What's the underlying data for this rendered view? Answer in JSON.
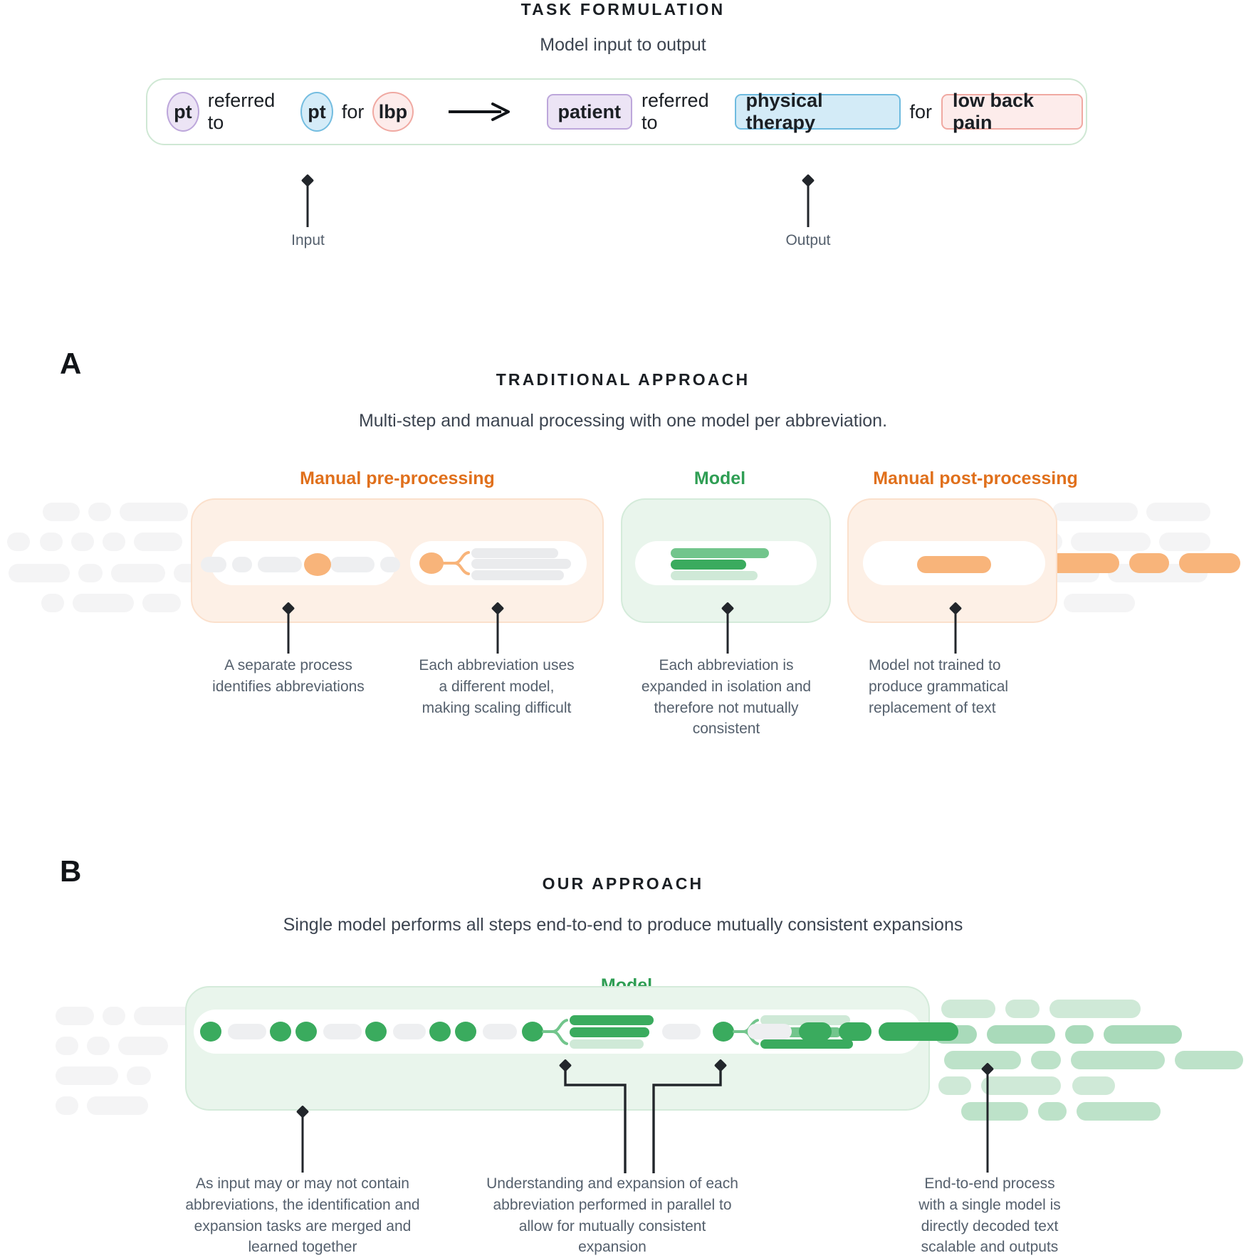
{
  "task_formulation": {
    "title": "TASK FORMULATION",
    "subtitle": "Model input to output",
    "input": {
      "tokens": [
        {
          "text": "pt",
          "kind": "abbr",
          "color": "purple"
        },
        {
          "text": "referred to",
          "kind": "plain"
        },
        {
          "text": "pt",
          "kind": "abbr",
          "color": "blue"
        },
        {
          "text": "for",
          "kind": "plain"
        },
        {
          "text": "lbp",
          "kind": "abbr",
          "color": "pink"
        }
      ]
    },
    "arrow_icon": "right-arrow-icon",
    "output": {
      "tokens": [
        {
          "text": "patient",
          "kind": "expansion",
          "color": "purple"
        },
        {
          "text": "referred to",
          "kind": "plain"
        },
        {
          "text": "physical therapy",
          "kind": "expansion",
          "color": "blue"
        },
        {
          "text": "for",
          "kind": "plain"
        },
        {
          "text": "low back pain",
          "kind": "expansion",
          "color": "pink"
        }
      ]
    },
    "input_label": "Input",
    "output_label": "Output"
  },
  "panel_a": {
    "letter": "A",
    "title": "TRADITIONAL APPROACH",
    "subtitle": "Multi-step and manual processing with one model per abbreviation.",
    "stage_labels": {
      "pre": "Manual pre-processing",
      "model": "Model",
      "post": "Manual post-processing"
    },
    "annotations": [
      "A separate process\nidentifies abbreviations",
      "Each abbreviation uses\na different model,\nmaking scaling difficult",
      "Each abbreviation is\nexpanded in isolation and\ntherefore not mutually\nconsistent",
      "Model not trained to\nproduce grammatical\nreplacement of text"
    ]
  },
  "panel_b": {
    "letter": "B",
    "title": "OUR APPROACH",
    "subtitle": "Single model performs all steps end-to-end to produce mutually consistent expansions",
    "stage_labels": {
      "model": "Model"
    },
    "annotations": [
      "As input may or may not contain\nabbreviations, the identification and\nexpansion tasks are merged and\nlearned together",
      "Understanding and expansion of each\nabbreviation performed in parallel to\nallow for mutually consistent\nexpansion",
      "End-to-end process\nwith a single model is\ndirectly decoded text\nscalable and outputs"
    ]
  },
  "colors": {
    "orange": "#e0701c",
    "orange_fill": "#f8b47a",
    "orange_band": "#fdf0e6",
    "green": "#2f9e54",
    "green_dark": "#3aab5e",
    "green_mid": "#72c58c",
    "green_light": "#cfe9d7",
    "green_band": "#e9f5ec",
    "grey_token": "#eeeff1",
    "text": "#3c4450",
    "purple_fill": "#ece4f5",
    "purple_border": "#bda7db",
    "blue_fill": "#d3ebf7",
    "blue_border": "#6fbbdf",
    "pink_fill": "#fdeceb",
    "pink_border": "#f0a9a2"
  }
}
